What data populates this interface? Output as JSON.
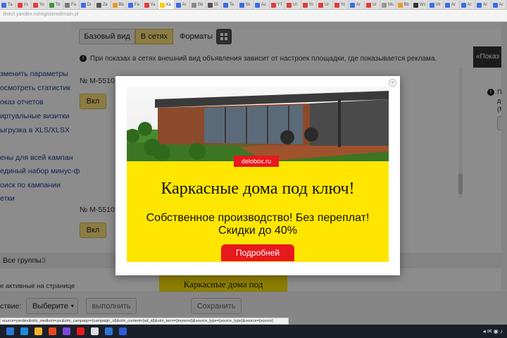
{
  "browser": {
    "tabs": [
      "Та",
      "Уз",
      "Yo",
      "Tb",
      "Fa",
      "Di",
      "Ze",
      "Bb",
      "Fa",
      "Ya",
      "Ка",
      "Ar",
      "Bb",
      "55",
      "Te",
      "Sk",
      "Ac",
      "YT",
      "Ut",
      "Yo",
      "Ur",
      "Yo",
      "Ar",
      "Ur",
      "Ms",
      "Bb",
      "Ws",
      "Vk",
      "Ar",
      "Ar",
      "Ar",
      "Ar"
    ],
    "active_tab_title": "Ка",
    "tab_colors": [
      "#3a6ee8",
      "#e23c3c",
      "#e23c3c",
      "#3a9a3a",
      "#7a7a7a",
      "#3a6ee8",
      "#555",
      "#e89a2a",
      "#3a6ee8",
      "#e23c3c",
      "#ffcc00",
      "#3a6ee8",
      "#888",
      "#555",
      "#3a6ee8",
      "#3a6ee8",
      "#3a6ee8",
      "#e23c3c",
      "#e23c3c",
      "#e23c3c",
      "#e23c3c",
      "#e23c3c",
      "#3a6ee8",
      "#e23c3c",
      "#999",
      "#e89a2a",
      "#333",
      "#3a6ee8",
      "#3a6ee8",
      "#3a6ee8",
      "#3a6ee8",
      "#3a6ee8"
    ],
    "url": "direct.yandex.ru/registered/main.pl"
  },
  "sidebar": {
    "items": [
      "зменить параметры",
      "осмотреть статистик",
      "оказ отчетов",
      "иртуальные визитки",
      "ыгрузка в XLS/XLSX",
      "ены для всей кампан",
      "единый набор минус-ф",
      "оиск по кампании",
      "етки"
    ]
  },
  "view_tabs": {
    "basic": "Базовый вид",
    "networks": "В сетях",
    "formats": "Форматы"
  },
  "info_text": "При показах в сетях внешний вид объявления зависит от настроек площадки, где показывается реклама.",
  "ads": [
    {
      "number": "№ M-5510",
      "toggle": "Вкл"
    },
    {
      "number": "№ M-5510",
      "toggle": "Вкл"
    }
  ],
  "right_panel": {
    "dark_label": "«Показ пo",
    "text_1": "По",
    "text_2": "дне",
    "text_3": "(M9"
  },
  "groups": {
    "label": "Все группы",
    "count": "3",
    "bottom_note": "е активные на странице"
  },
  "preview_title": "Каркасные дома под",
  "action_bar": {
    "label": "ствие:",
    "select": "Выберите",
    "execute": "выполнить",
    "save": "Сохранить"
  },
  "status_url": "source=yandex&utm_medium=cpc&utm_campaign={campaign_id}&utm_content={ad_id}&utm_term={keyword}&source_type={source_type}&source={source}",
  "modal": {
    "brand": "delobox.ru",
    "headline": "Каркасные дома под ключ!",
    "line1": "Собственное производство! Без переплат!",
    "line2": "Скидки до 40%",
    "cta": "Подробней"
  },
  "colors": {
    "yellow": "#ffe600",
    "red": "#e8181c",
    "link": "#1a3d8c",
    "active_tab": "#ffe27a"
  },
  "taskbar": {
    "time": "21:00"
  }
}
